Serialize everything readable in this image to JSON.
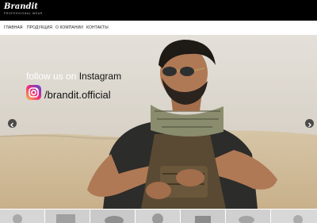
{
  "header": {
    "logo_text": "Brandit",
    "logo_tagline": "PROFESSIONAL WEAR"
  },
  "nav": {
    "items": [
      {
        "label": "ГЛАВНАЯ"
      },
      {
        "label": "ПРОДУКЦИЯ"
      },
      {
        "label": "О КОМПАНИИ"
      },
      {
        "label": "КОНТАКТЫ"
      }
    ]
  },
  "hero": {
    "follow_text": "follow us on",
    "platform": "Instagram",
    "handle": "/brandit.official",
    "icons": {
      "instagram": "instagram-icon",
      "prev": "chevron-left-icon",
      "next": "chevron-right-icon"
    }
  },
  "thumbnails": {
    "count_visible": 7
  },
  "colors": {
    "topbar": "#000000",
    "nav_text": "#222222",
    "arrow": "#333333"
  }
}
